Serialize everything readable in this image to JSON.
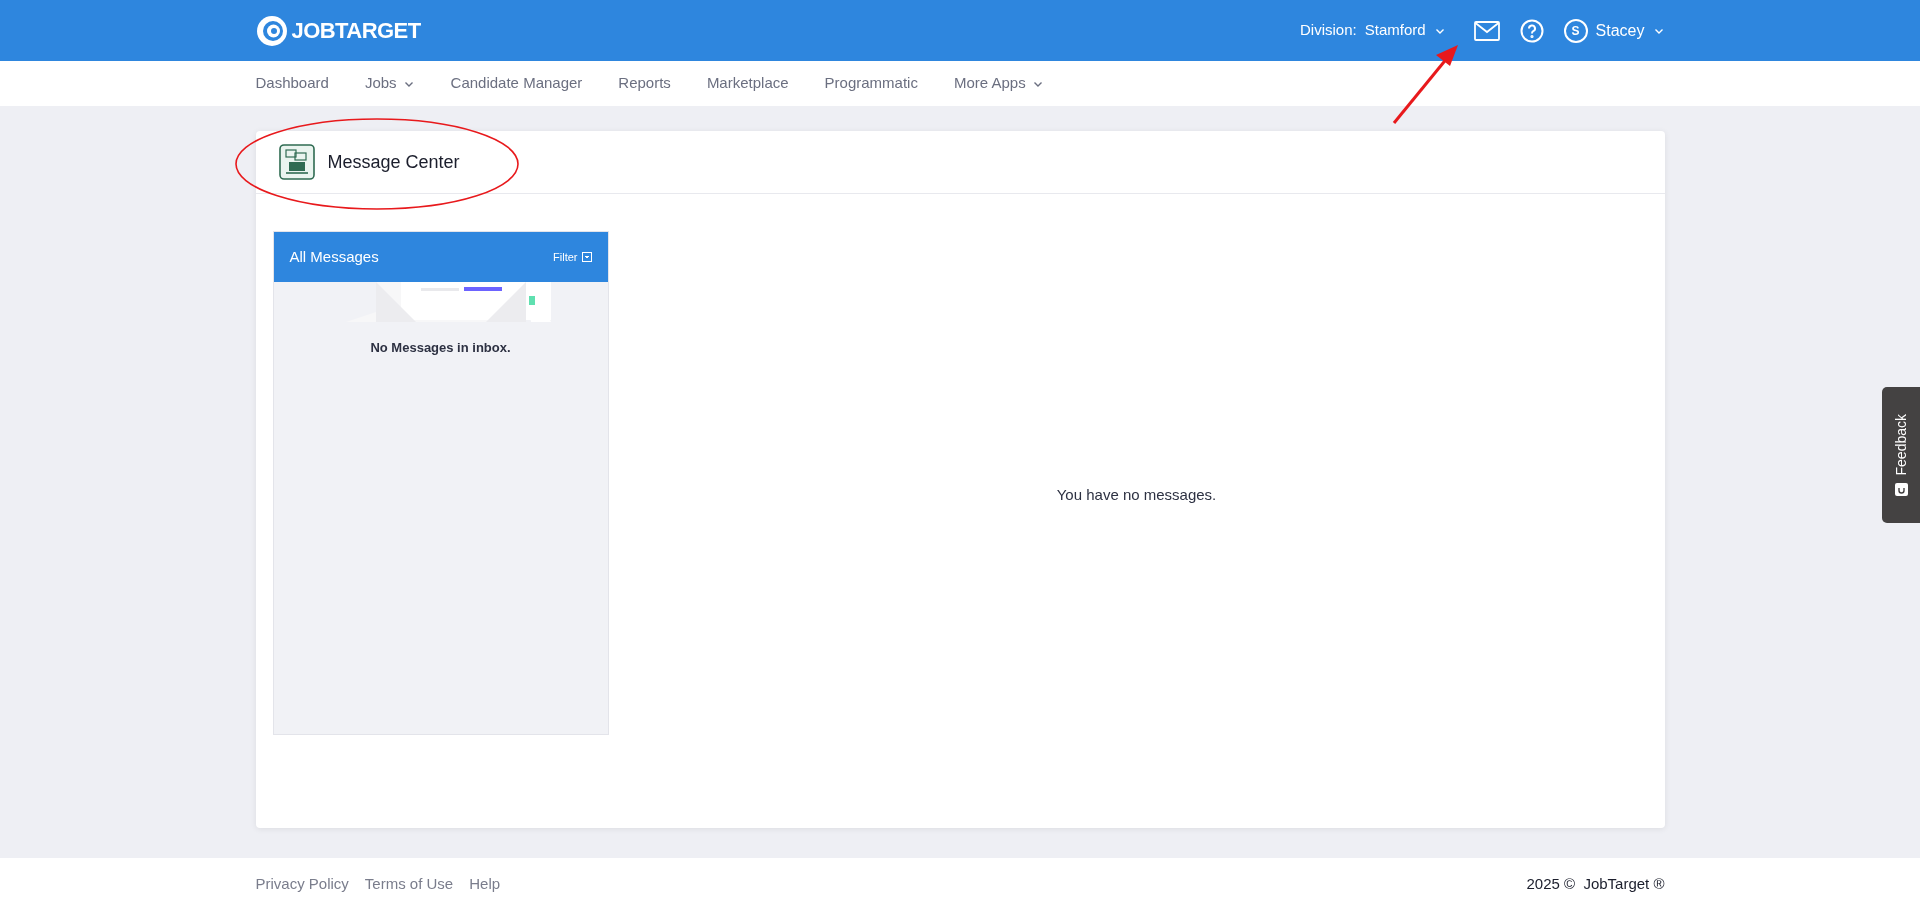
{
  "header": {
    "logo": "JOBTARGET",
    "division_label": "Division:",
    "division": "Stamford",
    "user_initial": "S",
    "user": "Stacey"
  },
  "nav": [
    {
      "label": "Dashboard",
      "dropdown": false
    },
    {
      "label": "Jobs",
      "dropdown": true
    },
    {
      "label": "Candidate Manager",
      "dropdown": false
    },
    {
      "label": "Reports",
      "dropdown": false
    },
    {
      "label": "Marketplace",
      "dropdown": false
    },
    {
      "label": "Programmatic",
      "dropdown": false
    },
    {
      "label": "More Apps",
      "dropdown": true
    }
  ],
  "page": {
    "title": "Message Center"
  },
  "inbox": {
    "title": "All Messages",
    "filter": "Filter",
    "empty": "No Messages in inbox."
  },
  "detail": {
    "empty": "You have no messages."
  },
  "feedback": {
    "label": "Feedback"
  },
  "footer": {
    "links": [
      "Privacy Policy",
      "Terms of Use",
      "Help"
    ],
    "copyright": "2025 ©  JobTarget ®"
  }
}
